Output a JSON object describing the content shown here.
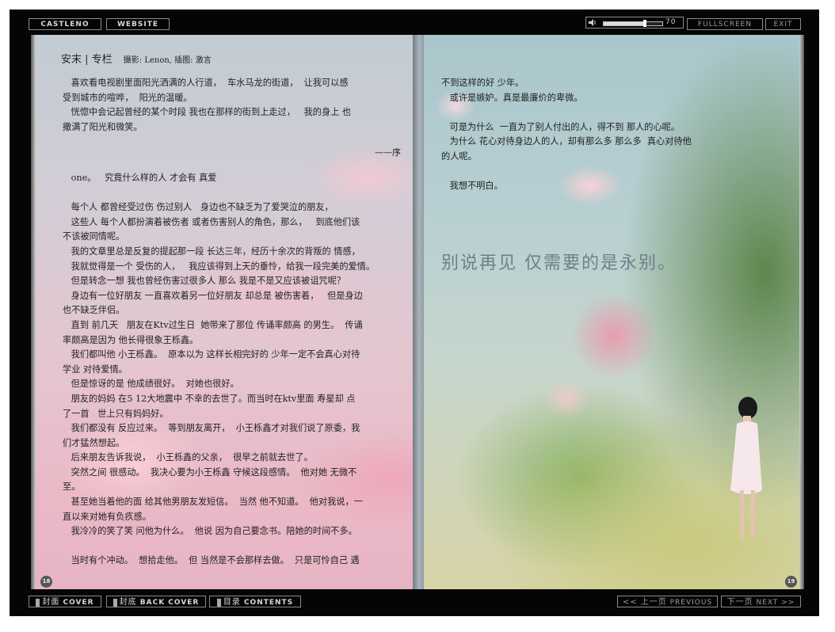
{
  "toolbar": {
    "castleno": "CASTLENO",
    "website": "WEBSITE",
    "volume_value": "70",
    "volume_level": 0.7,
    "fullscreen": "FULLSCREEN",
    "exit": "EXIT"
  },
  "left_page": {
    "title": "安末 | 专栏",
    "credits": "摄影: Lenon, 插图: 激言",
    "lines": [
      "   喜欢看电视剧里面阳光洒满的人行道，  车水马龙的街道，  让我可以感",
      "受到城市的喧哗，  阳光的温暖。",
      "   恍惚中会记起曾经的某个时段 我也在那样的街到上走过，   我的身上 也",
      "撒满了阳光和微笑。"
    ],
    "sign": "——序",
    "body": [
      "   one。   究竟什么样的人 才会有 真爱",
      "",
      "   每个人 都曾经受过伤 伤过别人   身边也不缺乏为了爱哭泣的朋友，",
      "   这些人 每个人都扮演着被伤者 或者伤害别人的角色，那么，   到底他们该",
      "不该被同情呢。",
      "   我的文章里总是反复的提起那一段 长达三年，经历十余次的背叛的 情感，",
      "   我就觉得是一个 受伤的人，   我应该得到上天的垂怜，给我一段完美的爱情。",
      "   但是转念一想 我也曾经伤害过很多人 那么 我是不是又应该被诅咒呢？",
      "   身边有一位好朋友 一直喜欢着另一位好朋友 却总是 被伤害着，   但是身边",
      "也不缺乏伴侣。",
      "   直到 前几天   朋友在Ktv过生日  她带来了那位 传诵率颇高 的男生。  传诵",
      "率颇高是因为 他长得很象王栎鑫。",
      "   我们都叫他 小王栎鑫。  原本以为 这样长相完好的 少年一定不会真心对待",
      "学业 对待爱情。",
      "   但是惊讶的是 他成绩很好。  对她也很好。",
      "   朋友的妈妈 在5 12大地震中 不幸的去世了。而当时在ktv里面 寿星却 点",
      "了一首   世上只有妈妈好。",
      "   我们都没有 反应过来。  等到朋友离开，  小王栎鑫才对我们说了原委，我",
      "们才猛然想起。",
      "   后来朋友告诉我说，  小王栎鑫的父亲，  很早之前就去世了。",
      "   突然之间 很感动。  我决心要为小王栎鑫 守候这段感情。  他对她 无微不",
      "至。",
      "   甚至她当着他的面 给其他男朋友发短信。  当然 他不知道。  他对我说，一",
      "直以来对她有负疚感。",
      "   我冷冷的笑了笑 问他为什么。  他说 因为自己要念书。陪她的时间不多。",
      "",
      "   当时有个冲动。  想拾走他。  但 当然是不会那样去做。  只是可怜自己 遇"
    ],
    "page_number": "18"
  },
  "right_page": {
    "lines": [
      "不到这样的好 少年。",
      "   或许是嫉妒。真是最廉价的卑微。",
      "",
      "   可是为什么  一直为了别人付出的人，得不到 那人的心呢。",
      "   为什么 花心对待身边人的人，却有那么多 那么多  真心对待他",
      "的人呢。",
      "",
      "   我想不明白。"
    ],
    "quote": "别说再见 仅需要的是永别。",
    "page_number": "19"
  },
  "bottom_nav": {
    "cover_cn": "封面",
    "cover_en": "COVER",
    "back_cover_cn": "封底",
    "back_cover_en": "BACK COVER",
    "contents_cn": "目录",
    "contents_en": "CONTENTS",
    "previous_cn": "<< 上一页",
    "previous_en": "PREVIOUS",
    "next_cn": "下一页",
    "next_en": "NEXT >>"
  },
  "colors": {
    "frame": "#050505",
    "button_border": "#8a8a8a",
    "quote": "#6f7f88"
  }
}
